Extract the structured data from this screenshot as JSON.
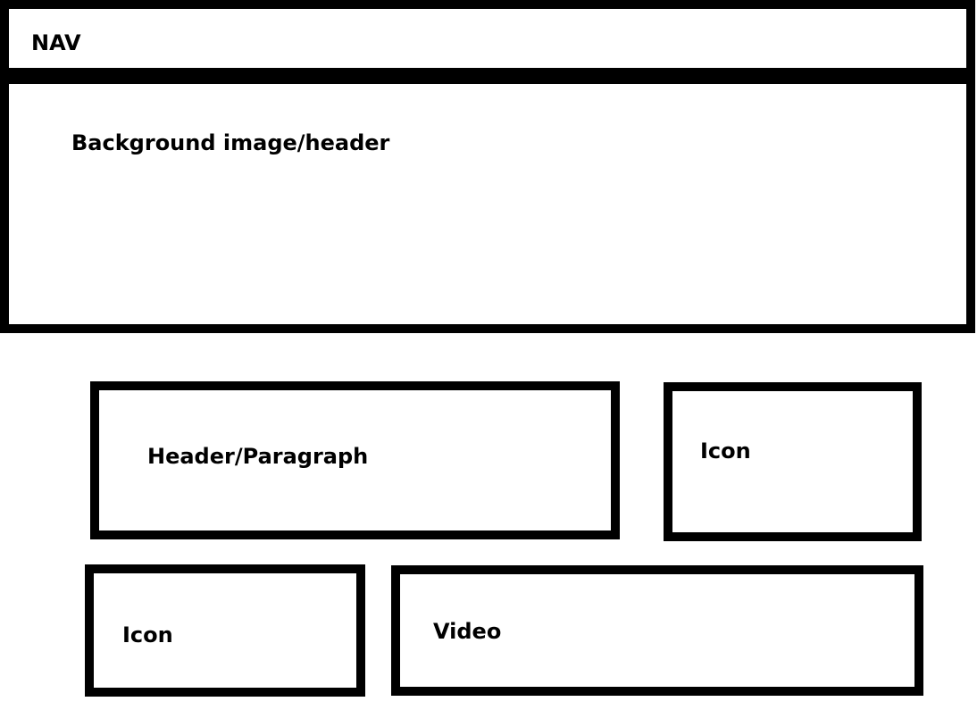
{
  "nav": {
    "label": "NAV"
  },
  "hero": {
    "label": "Background image/header"
  },
  "content": {
    "label": "Header/Paragraph"
  },
  "icon_right": {
    "label": "Icon"
  },
  "icon_left": {
    "label": "Icon"
  },
  "video": {
    "label": "Video"
  },
  "colors": {
    "border": "#000000",
    "background": "#ffffff"
  }
}
